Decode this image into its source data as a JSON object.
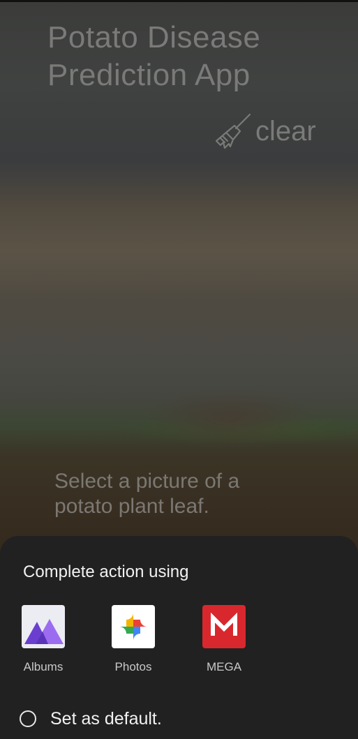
{
  "app": {
    "title_line1": "Potato Disease",
    "title_line2": "Prediction App",
    "clear_label": "clear",
    "prompt_line1": "Select a picture of a",
    "prompt_line2": "potato plant leaf."
  },
  "chooser": {
    "title": "Complete action using",
    "apps": [
      {
        "label": "Albums",
        "icon": "albums-icon"
      },
      {
        "label": "Photos",
        "icon": "google-photos-icon"
      },
      {
        "label": "MEGA",
        "icon": "mega-icon"
      }
    ],
    "default_label": "Set as default."
  },
  "colors": {
    "sheet_background": "#212121",
    "mega_red": "#d9272e",
    "albums_purple": "#7b4fd6"
  }
}
